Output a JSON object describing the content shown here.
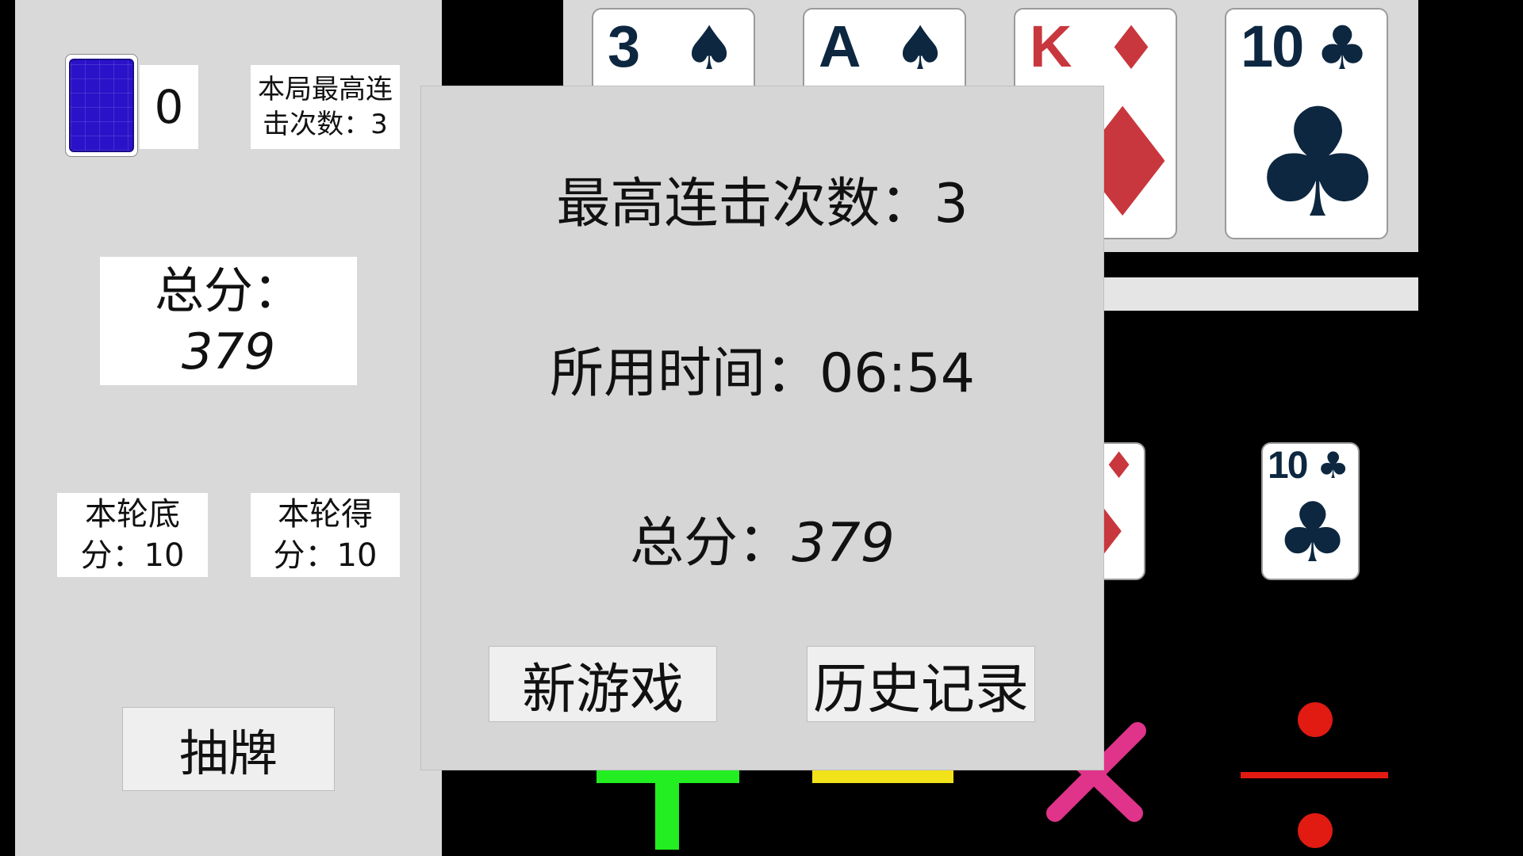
{
  "left_panel": {
    "deck_count": "0",
    "max_combo_round_label": "本局最高连击次数：",
    "max_combo_round_value": "3",
    "total_score_label": "总分：",
    "total_score_value": "379",
    "round_base_label": "本轮底分：",
    "round_base_value": "10",
    "round_gain_label": "本轮得分：",
    "round_gain_value": "10",
    "draw_button_label": "抽牌"
  },
  "tray_cards": [
    {
      "rank": "3",
      "suit": "spade-icon",
      "suit_glyph": "♠",
      "color": "black"
    },
    {
      "rank": "A",
      "suit": "spade-icon",
      "suit_glyph": "♠",
      "color": "black"
    },
    {
      "rank": "K",
      "suit": "diamond-icon",
      "suit_glyph": "♦",
      "color": "red"
    },
    {
      "rank": "10",
      "suit": "club-icon",
      "suit_glyph": "♣",
      "color": "black"
    }
  ],
  "selected_cards": [
    {
      "rank": "K",
      "suit": "diamond-icon",
      "suit_glyph": "♦",
      "color": "red"
    },
    {
      "rank": "10",
      "suit": "club-icon",
      "suit_glyph": "♣",
      "color": "black"
    }
  ],
  "operators": [
    {
      "name": "plus-operator",
      "color": "#22ee22"
    },
    {
      "name": "minus-operator",
      "color": "#f2e21a"
    },
    {
      "name": "multiply-operator",
      "color": "#e0338a"
    },
    {
      "name": "divide-operator",
      "color": "#e11a12"
    }
  ],
  "dialog": {
    "max_combo_label": "最高连击次数：",
    "max_combo_value": "3",
    "time_label": "所用时间：",
    "time_value": "06:54",
    "score_label": "总分：",
    "score_value": "379",
    "new_game_label": "新游戏",
    "history_label": "历史记录"
  },
  "colors": {
    "panel_bg": "#d9d9d9",
    "card_back": "#2a12c9",
    "black_suit": "#0d2740",
    "red_suit": "#c8373d"
  }
}
